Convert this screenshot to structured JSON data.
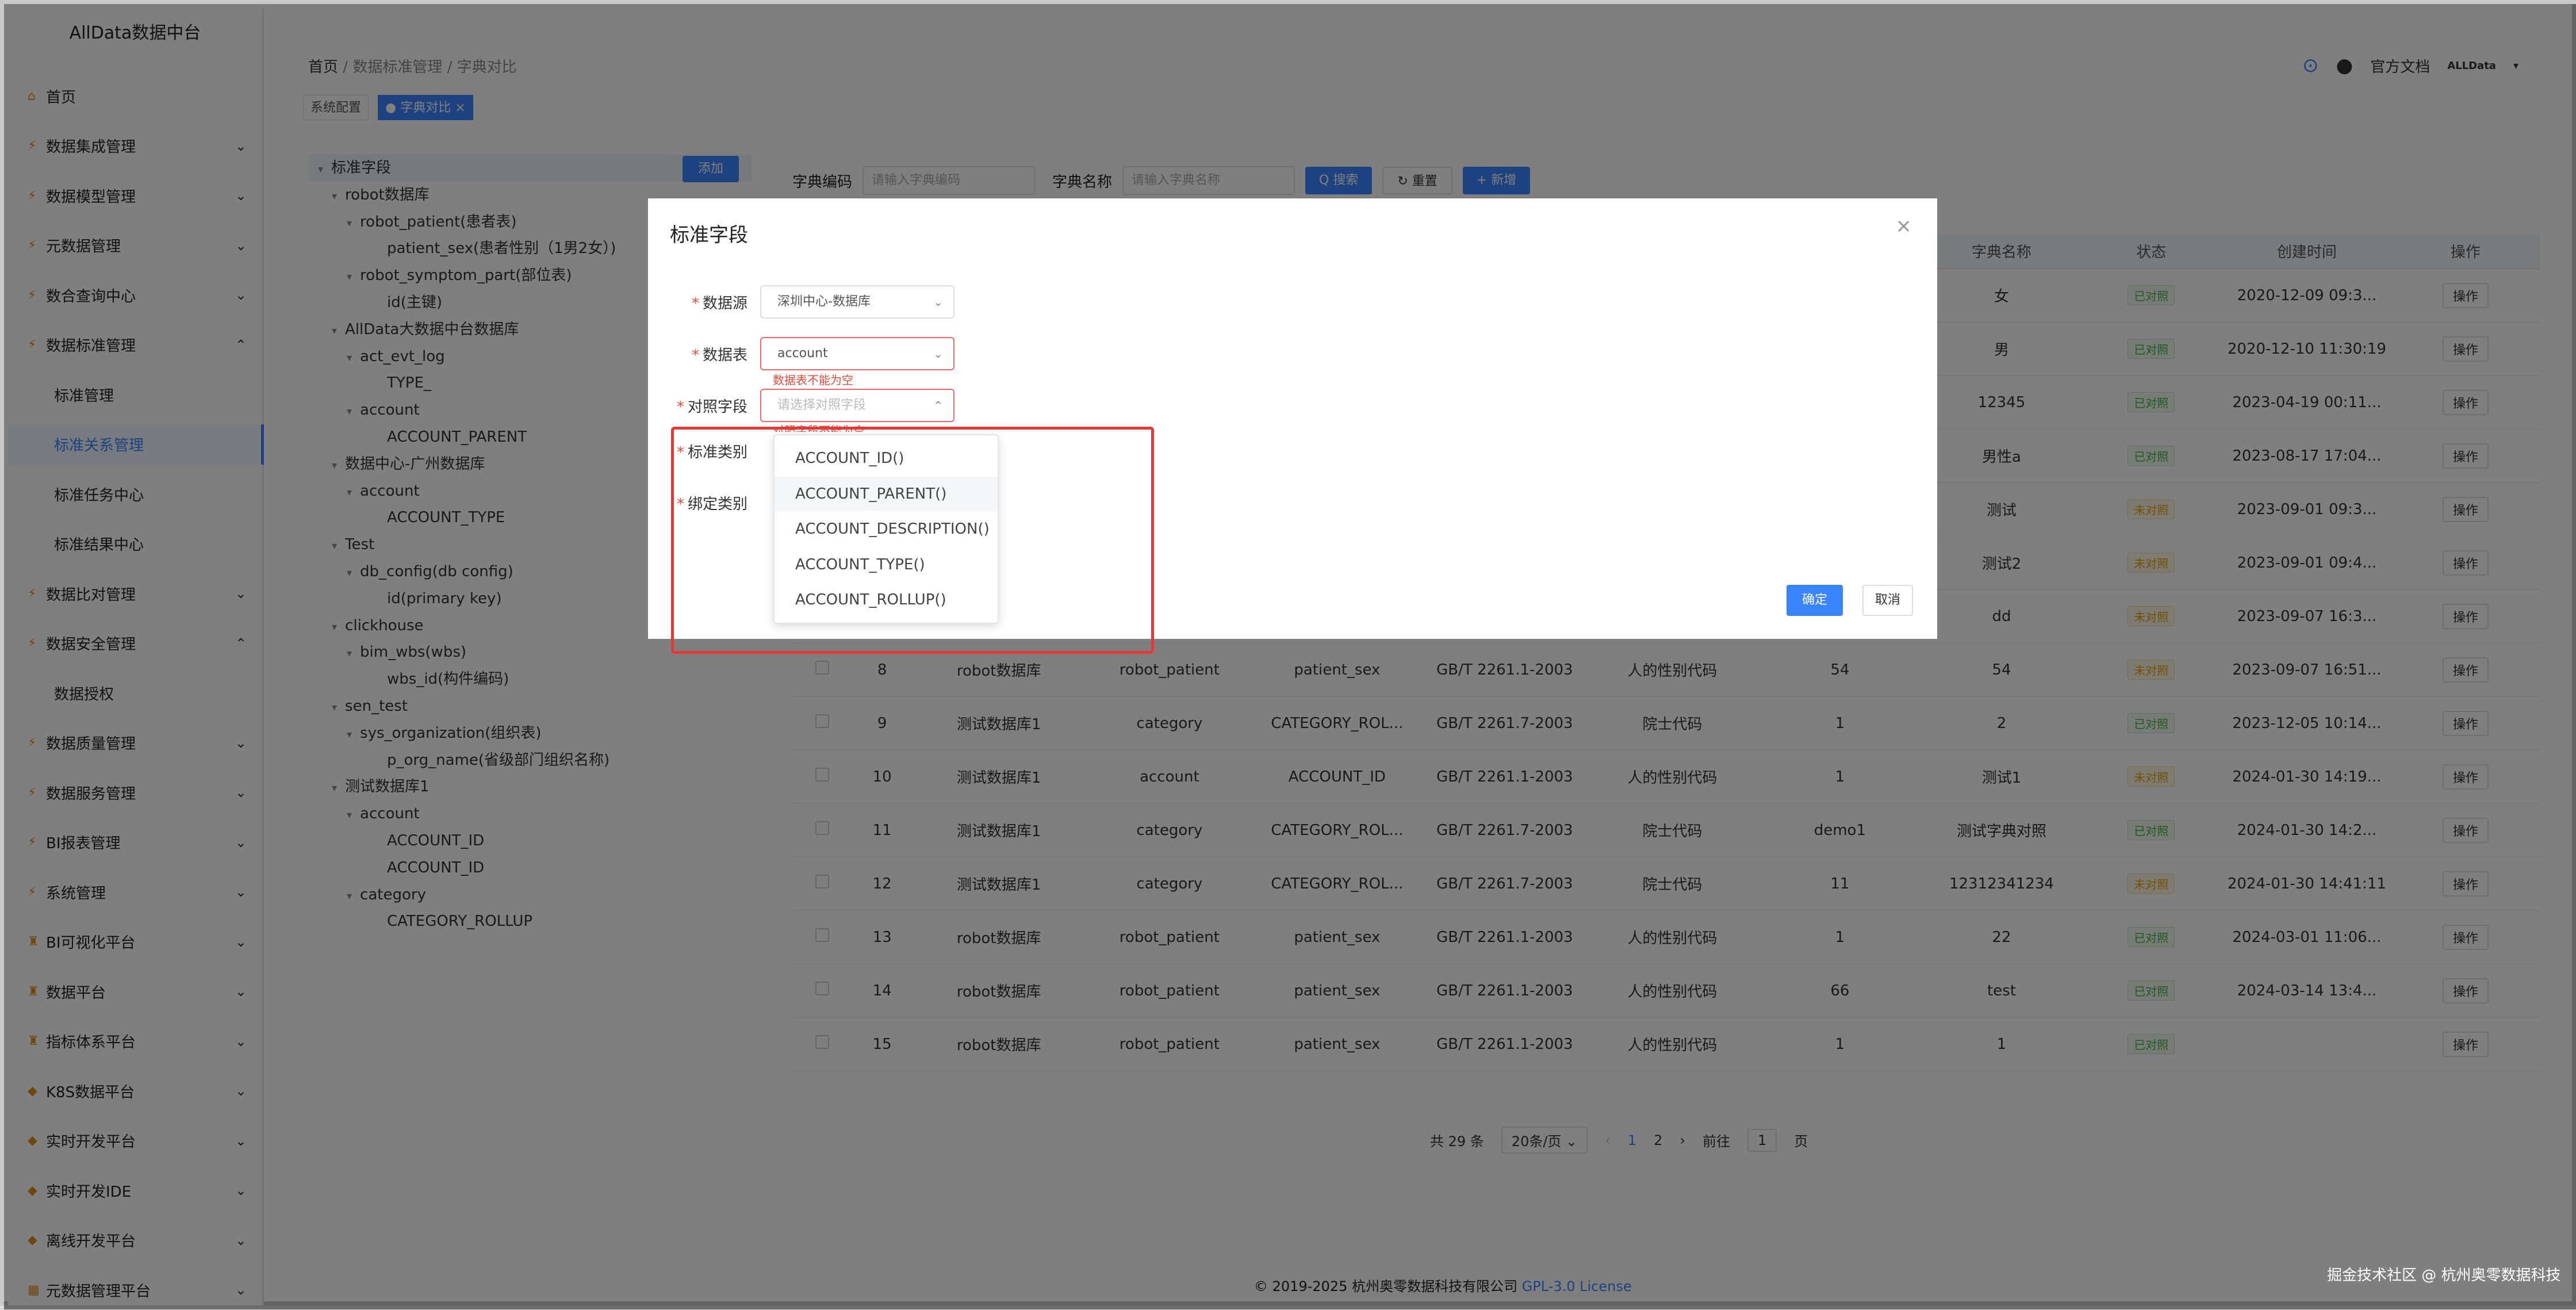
{
  "app": {
    "title": "AllData数据中台"
  },
  "sidebar": {
    "items": [
      {
        "label": "首页",
        "icon": "home-icon",
        "chevron": ""
      },
      {
        "label": "数据集成管理",
        "icon": "bolt-icon",
        "chevron": "⌄"
      },
      {
        "label": "数据模型管理",
        "icon": "bolt-icon",
        "chevron": "⌄"
      },
      {
        "label": "元数据管理",
        "icon": "bolt-icon",
        "chevron": "⌄"
      },
      {
        "label": "数合查询中心",
        "icon": "bolt-icon",
        "chevron": "⌄"
      },
      {
        "label": "数据标准管理",
        "icon": "bolt-icon",
        "chevron": "⌃"
      },
      {
        "label": "标准管理",
        "sub": true
      },
      {
        "label": "标准关系管理",
        "sub": true,
        "active": true
      },
      {
        "label": "标准任务中心",
        "sub": true
      },
      {
        "label": "标准结果中心",
        "sub": true
      },
      {
        "label": "数据比对管理",
        "icon": "bolt-icon",
        "chevron": "⌄"
      },
      {
        "label": "数据安全管理",
        "icon": "bolt-icon",
        "chevron": "⌃"
      },
      {
        "label": "数据授权",
        "sub": true
      },
      {
        "label": "数据质量管理",
        "icon": "bolt-icon",
        "chevron": "⌄"
      },
      {
        "label": "数据服务管理",
        "icon": "bolt-icon",
        "chevron": "⌄"
      },
      {
        "label": "BI报表管理",
        "icon": "bolt-icon",
        "chevron": "⌄"
      },
      {
        "label": "系统管理",
        "icon": "bolt-icon",
        "chevron": "⌄"
      },
      {
        "label": "BI可视化平台",
        "icon": "run-icon",
        "chevron": "⌄"
      },
      {
        "label": "数据平台",
        "icon": "run-icon",
        "chevron": "⌄"
      },
      {
        "label": "指标体系平台",
        "icon": "run-icon",
        "chevron": "⌄"
      },
      {
        "label": "K8S数据平台",
        "icon": "diamond-icon",
        "chevron": "⌄"
      },
      {
        "label": "实时开发平台",
        "icon": "diamond-icon",
        "chevron": "⌄"
      },
      {
        "label": "实时开发IDE",
        "icon": "diamond-icon",
        "chevron": "⌄"
      },
      {
        "label": "离线开发平台",
        "icon": "diamond-icon",
        "chevron": "⌄"
      },
      {
        "label": "元数据管理平台",
        "icon": "chart-icon",
        "chevron": "⌄"
      }
    ]
  },
  "header": {
    "breadcrumb": [
      "首页",
      "数据标准管理",
      "字典对比"
    ],
    "docs_label": "官方文档",
    "brand_label": "ALLData"
  },
  "tags": [
    "系统配置",
    "● 字典对比 ×"
  ],
  "tree": {
    "add_label": "添加",
    "nodes": [
      {
        "label": "标准字段",
        "level": 0,
        "caret": "▾"
      },
      {
        "label": "robot数据库",
        "level": 1,
        "caret": "▾"
      },
      {
        "label": "robot_patient(患者表)",
        "level": 2,
        "caret": "▾"
      },
      {
        "label": "patient_sex(患者性别（1男2女）)",
        "level": 3,
        "caret": ""
      },
      {
        "label": "robot_symptom_part(部位表)",
        "level": 2,
        "caret": "▾"
      },
      {
        "label": "id(主键)",
        "level": 3,
        "caret": ""
      },
      {
        "label": "AllData大数据中台数据库",
        "level": 1,
        "caret": "▾"
      },
      {
        "label": "act_evt_log",
        "level": 2,
        "caret": "▾"
      },
      {
        "label": "TYPE_",
        "level": 3,
        "caret": ""
      },
      {
        "label": "account",
        "level": 2,
        "caret": "▾"
      },
      {
        "label": "ACCOUNT_PARENT",
        "level": 3,
        "caret": ""
      },
      {
        "label": "数据中心-广州数据库",
        "level": 1,
        "caret": "▾"
      },
      {
        "label": "account",
        "level": 2,
        "caret": "▾"
      },
      {
        "label": "ACCOUNT_TYPE",
        "level": 3,
        "caret": ""
      },
      {
        "label": "Test",
        "level": 1,
        "caret": "▾"
      },
      {
        "label": "db_config(db config)",
        "level": 2,
        "caret": "▾"
      },
      {
        "label": "id(primary key)",
        "level": 3,
        "caret": ""
      },
      {
        "label": "clickhouse",
        "level": 1,
        "caret": "▾"
      },
      {
        "label": "bim_wbs(wbs)",
        "level": 2,
        "caret": "▾"
      },
      {
        "label": "wbs_id(构件编码)",
        "level": 3,
        "caret": ""
      },
      {
        "label": "sen_test",
        "level": 1,
        "caret": "▾"
      },
      {
        "label": "sys_organization(组织表)",
        "level": 2,
        "caret": "▾"
      },
      {
        "label": "p_org_name(省级部门组织名称)",
        "level": 3,
        "caret": ""
      },
      {
        "label": "测试数据库1",
        "level": 1,
        "caret": "▾"
      },
      {
        "label": "account",
        "level": 2,
        "caret": "▾"
      },
      {
        "label": "ACCOUNT_ID",
        "level": 3,
        "caret": ""
      },
      {
        "label": "ACCOUNT_ID",
        "level": 3,
        "caret": ""
      },
      {
        "label": "category",
        "level": 2,
        "caret": "▾"
      },
      {
        "label": "CATEGORY_ROLLUP",
        "level": 3,
        "caret": ""
      }
    ]
  },
  "search": {
    "code_label": "字典编码",
    "code_placeholder": "请输入字典编码",
    "name_label": "字典名称",
    "name_placeholder": "请输入字典名称",
    "search_btn": "Q 搜索",
    "reset_btn": "↻ 重置",
    "add_btn": "+ 新增"
  },
  "table": {
    "headers": [
      "",
      "",
      "",
      "",
      "",
      "",
      "",
      "",
      "字典名称",
      "状态",
      "创建时间",
      "操作"
    ],
    "rows": [
      [
        "",
        "",
        "",
        "",
        "",
        "",
        "",
        "",
        "女",
        "已对照",
        "2020-12-09 09:3...",
        "操作"
      ],
      [
        "",
        "",
        "",
        "",
        "",
        "",
        "",
        "",
        "男",
        "已对照",
        "2020-12-10 11:30:19",
        "操作"
      ],
      [
        "",
        "",
        "",
        "",
        "",
        "",
        "",
        "",
        "12345",
        "已对照",
        "2023-04-19 00:11...",
        "操作"
      ],
      [
        "",
        "",
        "",
        "",
        "",
        "",
        "",
        "",
        "男性a",
        "已对照",
        "2023-08-17 17:04...",
        "操作"
      ],
      [
        "",
        "",
        "",
        "",
        "",
        "",
        "",
        "",
        "测试",
        "未对照",
        "2023-09-01 09:3...",
        "操作"
      ],
      [
        "",
        "",
        "",
        "",
        "",
        "",
        "",
        "",
        "测试2",
        "未对照",
        "2023-09-01 09:4...",
        "操作"
      ],
      [
        "",
        "",
        "",
        "",
        "",
        "",
        "",
        "",
        "dd",
        "未对照",
        "2023-09-07 16:3...",
        "操作"
      ],
      [
        "",
        "8",
        "robot数据库",
        "robot_patient",
        "patient_sex",
        "GB/T 2261.1-2003",
        "人的性别代码",
        "54",
        "54",
        "未对照",
        "2023-09-07 16:51...",
        "操作"
      ],
      [
        "",
        "9",
        "测试数据库1",
        "category",
        "CATEGORY_ROL...",
        "GB/T 2261.7-2003",
        "院士代码",
        "1",
        "2",
        "已对照",
        "2023-12-05 10:14...",
        "操作"
      ],
      [
        "",
        "10",
        "测试数据库1",
        "account",
        "ACCOUNT_ID",
        "GB/T 2261.1-2003",
        "人的性别代码",
        "1",
        "测试1",
        "未对照",
        "2024-01-30 14:19...",
        "操作"
      ],
      [
        "",
        "11",
        "测试数据库1",
        "category",
        "CATEGORY_ROL...",
        "GB/T 2261.7-2003",
        "院士代码",
        "demo1",
        "测试字典对照",
        "已对照",
        "2024-01-30 14:2...",
        "操作"
      ],
      [
        "",
        "12",
        "测试数据库1",
        "category",
        "CATEGORY_ROL...",
        "GB/T 2261.7-2003",
        "院士代码",
        "11",
        "12312341234",
        "未对照",
        "2024-01-30 14:41:11",
        "操作"
      ],
      [
        "",
        "13",
        "robot数据库",
        "robot_patient",
        "patient_sex",
        "GB/T 2261.1-2003",
        "人的性别代码",
        "1",
        "22",
        "已对照",
        "2024-03-01 11:06...",
        "操作"
      ],
      [
        "",
        "14",
        "robot数据库",
        "robot_patient",
        "patient_sex",
        "GB/T 2261.1-2003",
        "人的性别代码",
        "66",
        "test",
        "已对照",
        "2024-03-14 13:4...",
        "操作"
      ],
      [
        "",
        "15",
        "robot数据库",
        "robot_patient",
        "patient_sex",
        "GB/T 2261.1-2003",
        "人的性别代码",
        "1",
        "1",
        "已对照",
        "",
        "操作"
      ]
    ]
  },
  "pager": {
    "total": "共 29 条",
    "page_size": "20条/页 ⌄",
    "prev": "‹",
    "page1": "1",
    "page2": "2",
    "next": "›",
    "goto_label": "前往",
    "goto_value": "1",
    "page_unit": "页"
  },
  "footer": {
    "copyright": "© 2019-2025 杭州奥零数据科技有限公司 ",
    "license": "GPL-3.0 License"
  },
  "watermark": "掘金技术社区 @ 杭州奥零数据科技",
  "dialog": {
    "title": "标准字段",
    "close": "×",
    "fields": [
      {
        "label": "数据源",
        "value": "深圳中心-数据库",
        "placeholder": "",
        "arrow": "⌄"
      },
      {
        "label": "数据表",
        "value": "account",
        "placeholder": "",
        "arrow": "⌄"
      },
      {
        "label": "对照字段",
        "value": "",
        "placeholder": "请选择对照字段",
        "arrow": "⌃"
      },
      {
        "label": "标准类别"
      },
      {
        "label": "绑定类别"
      }
    ],
    "table_error": "数据表不能为空",
    "field_error": "对照字段不能为空",
    "ok_label": "确定",
    "cancel_label": "取消"
  },
  "dropdown": {
    "options": [
      "ACCOUNT_ID()",
      "ACCOUNT_PARENT()",
      "ACCOUNT_DESCRIPTION()",
      "ACCOUNT_TYPE()",
      "ACCOUNT_ROLLUP()"
    ],
    "hovered_index": 1
  },
  "colors": {
    "accent": "#3a84ff",
    "highlight": "#e53935",
    "ok": "#47b04b",
    "warn": "#e0a30b"
  }
}
